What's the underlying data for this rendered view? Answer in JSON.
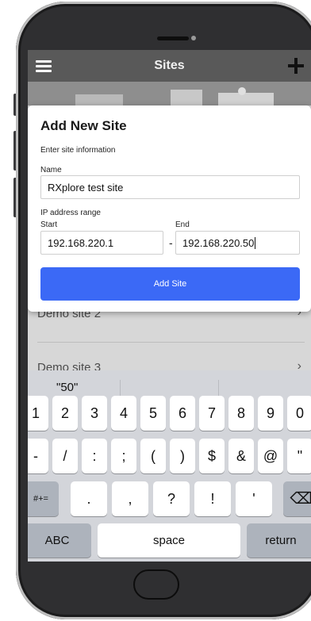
{
  "nav": {
    "title": "Sites"
  },
  "list": {
    "items": [
      {
        "label": "Demo site 2"
      },
      {
        "label": "Demo site 3"
      }
    ]
  },
  "modal": {
    "title": "Add New Site",
    "subtitle": "Enter site information",
    "name_label": "Name",
    "name_value": "RXplore test site",
    "ip_label": "IP address range",
    "start_label": "Start",
    "start_value": "192.168.220.1",
    "dash": "-",
    "end_label": "End",
    "end_value": "192.168.220.50",
    "button_label": "Add Site"
  },
  "keyboard": {
    "suggestion": "\"50\"",
    "row1": [
      "1",
      "2",
      "3",
      "4",
      "5",
      "6",
      "7",
      "8",
      "9",
      "0"
    ],
    "row2": [
      "-",
      "/",
      ":",
      ";",
      "(",
      ")",
      "$",
      "&",
      "@",
      "\""
    ],
    "row3": [
      ".",
      ",",
      "?",
      "!",
      "'"
    ],
    "symbols_key": "#+=",
    "abc_key": "ABC",
    "space_key": "space",
    "return_key": "return",
    "delete_glyph": "⌫"
  },
  "colors": {
    "accent": "#3b69f6",
    "navbar": "#595959",
    "keyboard": "#d3d5da"
  }
}
